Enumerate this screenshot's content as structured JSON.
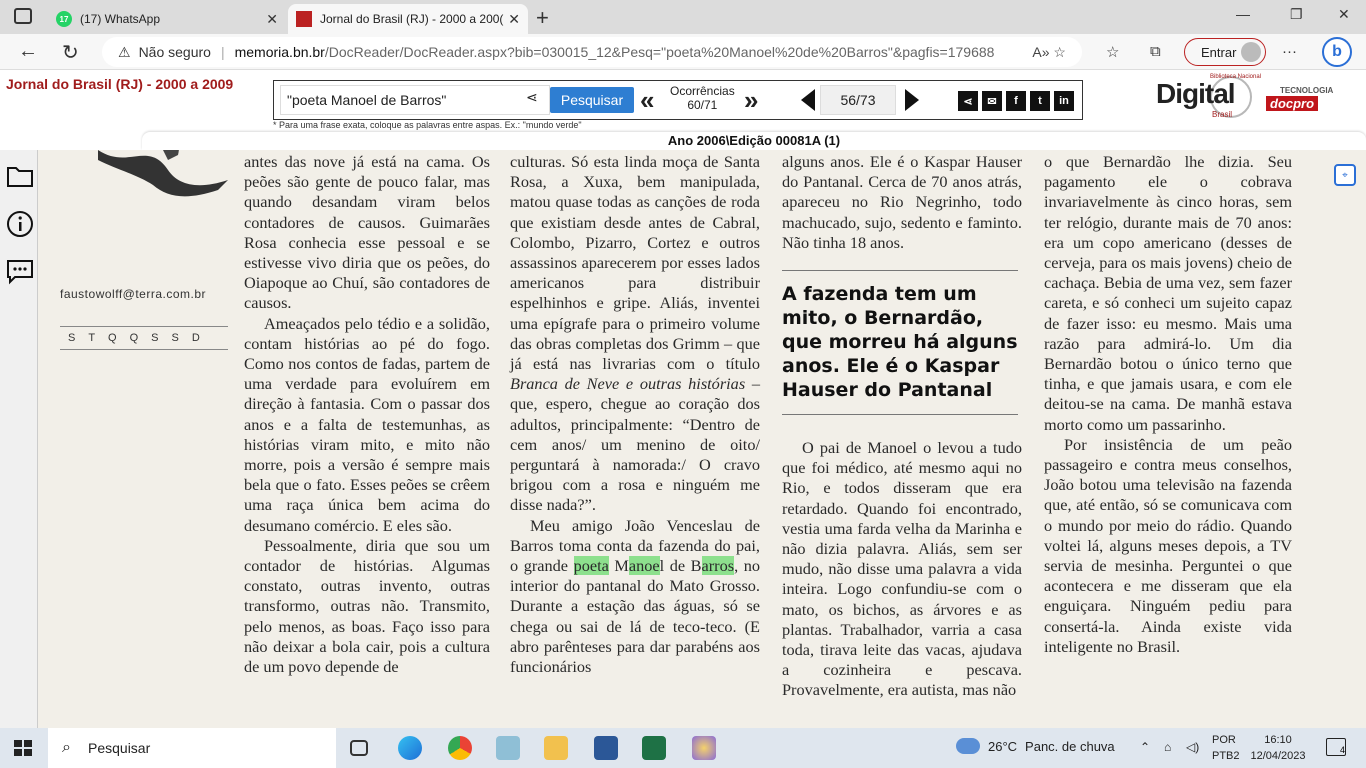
{
  "browser": {
    "tabs": [
      {
        "label": "(17) WhatsApp",
        "badge": "17"
      },
      {
        "label": "Jornal do Brasil (RJ) - 2000 a 200("
      }
    ],
    "security_label": "Não seguro",
    "url_host": "memoria.bn.br",
    "url_path": "/DocReader/DocReader.aspx?bib=030015_12&Pesq=\"poeta%20Manoel%20de%20Barros\"&pagfis=179688",
    "signin_label": "Entrar"
  },
  "header": {
    "site_title": "Jornal do Brasil (RJ) - 2000 a 2009",
    "search_value": "\"poeta Manoel de Barros\"",
    "search_button": "Pesquisar",
    "occurrences_label": "Ocorrências",
    "occurrences_value": "60/71",
    "page_current": "56",
    "page_total": "/73",
    "hint": "* Para uma frase exata, coloque as palavras entre aspas. Ex.: \"mundo verde\"",
    "edition": "Ano 2006\\Edição 00081A (1)",
    "logo_digital": "Digital",
    "logo_bn": "Biblioteca Nacional",
    "logo_brasil": "Brasil",
    "logo_tec": "TECNOLOGIA",
    "logo_docpro": "docpro",
    "socials": [
      "f",
      "t",
      "in"
    ]
  },
  "newspaper": {
    "email": "faustowolff@terra.com.br",
    "days": "STQQSSD",
    "col1": [
      "antes das nove já está na cama. Os peões são gente de pouco falar, mas quando desandam viram belos contadores de causos. Guimarães Rosa conhecia esse pessoal e se estivesse vivo diria que os peões, do Oiapoque ao Chuí, são contadores de causos.",
      "Ameaçados pelo tédio e a solidão, contam histórias ao pé do fogo. Como nos contos de fadas, partem de uma verdade para evoluírem em direção à fantasia. Com o passar dos anos e a falta de testemunhas, as histórias viram mito, e mito não morre, pois a versão é sempre mais bela que o fato. Esses peões se crêem uma raça única bem acima do desumano comércio. E eles são.",
      "Pessoalmente, diria que sou um contador de histórias. Algumas constato, outras invento, outras transformo, outras não. Transmito, pelo menos, as boas. Faço isso para não deixar a bola cair, pois a cultura de um povo depende de"
    ],
    "col2_p1": "culturas. Só esta linda moça de Santa Rosa, a Xuxa, bem manipulada, matou quase todas as canções de roda que existiam desde antes de Cabral, Colombo, Pizarro, Cortez e outros assassinos aparecerem por esses lados americanos para distribuir espelhinhos e gripe. Aliás, inventei uma epígrafe para o primeiro volume das obras completas dos Grimm – que já está nas livrarias com o título",
    "col2_title": "Branca de Neve e outras histórias",
    "col2_p1_end": " – que, espero, chegue ao coração dos adultos, principalmente: “Dentro de cem anos/ um menino de oito/ perguntará à namorada:/ O cravo brigou com a rosa e ninguém me disse nada?”.",
    "col2_p2_a": "Meu amigo João Venceslau de Barros toma conta da fazenda do pai, o grande ",
    "col2_hl1": "poeta",
    "col2_p2_b": " M",
    "col2_hl2": "anoe",
    "col2_p2_c": "l de B",
    "col2_hl3": "arros",
    "col2_p2_d": ", no interior do pantanal do Mato Grosso. Durante a estação das águas, só se chega ou sai de lá de teco-teco. (E abro parênteses para dar parabéns aos funcionários",
    "col3_top": "alguns anos. Ele é o Kaspar Hauser do Pantanal. Cerca de 70 anos atrás, apareceu no Rio Negrinho, todo machucado, sujo, sedento e faminto. Não tinha 18 anos.",
    "headline": "A fazenda tem um mito, o Bernardão, que morreu há alguns anos. Ele é o Kaspar Hauser do Pantanal",
    "col3_body": "O pai de Manoel o levou a tudo que foi médico, até mesmo aqui no Rio, e todos disseram que era retardado. Quando foi encontrado, vestia uma farda velha da Marinha e não dizia palavra. Aliás, sem ser mudo, não disse uma palavra a vida inteira. Logo confundiu-se com o mato, os bichos, as árvores e as plantas. Trabalhador, varria a casa toda, tirava leite das vacas, ajudava a cozinheira e pescava. Provavelmente, era autista, mas não",
    "col4": [
      "o que Bernardão lhe dizia. Seu pagamento ele o cobrava invariavelmente às cinco horas, sem ter relógio, durante mais de 70 anos: era um copo americano (desses de cerveja, para os mais jovens) cheio de cachaça. Bebia de uma vez, sem fazer careta, e só conheci um sujeito capaz de fazer isso: eu mesmo. Mais uma razão para admirá-lo. Um dia Bernardão botou o único terno que tinha, e que jamais usara, e com ele deitou-se na cama. De manhã estava morto como um passarinho.",
      "Por insistência de um peão passageiro e contra meus conselhos, João botou uma televisão na fazenda que, até então, só se comunicava com o mundo por meio do rádio. Quando voltei lá, alguns meses depois, a TV servia de mesinha. Perguntei o que acontecera e me disseram que ela enguiçara. Ninguém pediu para consertá-la. Ainda existe vida inteligente no Brasil."
    ]
  },
  "taskbar": {
    "search_placeholder": "Pesquisar",
    "weather_temp": "26°C",
    "weather_desc": "Panc. de chuva",
    "lang_1": "POR",
    "lang_2": "PTB2",
    "time": "16:10",
    "date": "12/04/2023",
    "notifications": "4"
  }
}
